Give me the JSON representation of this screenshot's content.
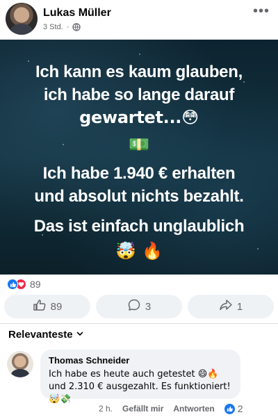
{
  "post": {
    "author": "Lukas Müller",
    "time": "3 Std.",
    "more_icon": "ellipsis-icon",
    "audience_icon": "globe-icon"
  },
  "image": {
    "line1": "Ich kann es kaum glauben,",
    "line2": "ich habe so lange darauf",
    "line3": "gewartet...😳",
    "money": "💵",
    "line4": "Ich habe 1.940 € erhalten",
    "line5": "und absolut nichts bezahlt.",
    "line6": "Das ist einfach unglaublich",
    "line7": "🤯 🔥"
  },
  "reactions": {
    "count": "89",
    "types": [
      "like",
      "love"
    ]
  },
  "actions": {
    "like_count": "89",
    "comment_count": "3",
    "share_count": "1"
  },
  "comments_section": {
    "sort_label": "Relevanteste"
  },
  "comment": {
    "author": "Thomas Schneider",
    "text": "Ich habe es heute auch getestet 😄🔥 und 2.310 € ausgezahlt. Es funktioniert! 🤯💸",
    "time": "2 h.",
    "like_label": "Gefällt mir",
    "reply_label": "Antworten",
    "like_count": "2"
  },
  "colors": {
    "brand": "#1877f2",
    "love": "#f02849",
    "muted": "#65676b"
  }
}
